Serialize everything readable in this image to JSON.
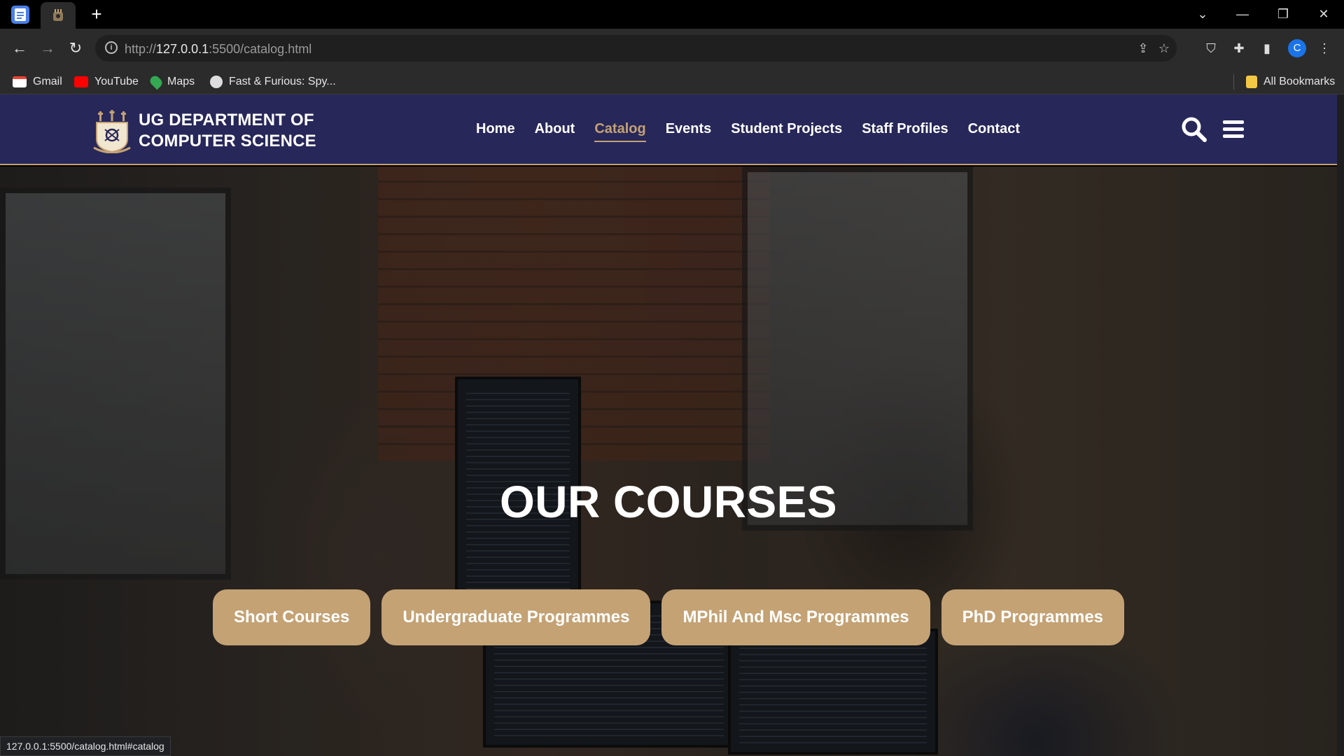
{
  "browser": {
    "url_prefix": "http://",
    "url_host": "127.0.0.1",
    "url_rest": ":5500/catalog.html",
    "new_tab": "+",
    "profile_initial": "C",
    "bookmarks": [
      {
        "label": "Gmail",
        "icon": "gmail-icon",
        "color": "#ea4335"
      },
      {
        "label": "YouTube",
        "icon": "youtube-icon",
        "color": "#ff0000"
      },
      {
        "label": "Maps",
        "icon": "maps-icon",
        "color": "#34a853"
      },
      {
        "label": "Fast & Furious: Spy...",
        "icon": "globe-icon",
        "color": "#dddddd"
      }
    ],
    "all_bookmarks": "All Bookmarks",
    "status_url": "127.0.0.1:5500/catalog.html#catalog"
  },
  "site": {
    "brand_line1": "UG DEPARTMENT OF",
    "brand_line2": "COMPUTER SCIENCE",
    "nav": [
      "Home",
      "About",
      "Catalog",
      "Events",
      "Student Projects",
      "Staff Profiles",
      "Contact"
    ],
    "active_nav": "Catalog",
    "hero_title": "OUR COURSES",
    "course_buttons": [
      "Short Courses",
      "Undergraduate Programmes",
      "MPhil And Msc Programmes",
      "PhD Programmes"
    ],
    "colors": {
      "header_bg": "#27275a",
      "accent": "#c4a274"
    }
  }
}
